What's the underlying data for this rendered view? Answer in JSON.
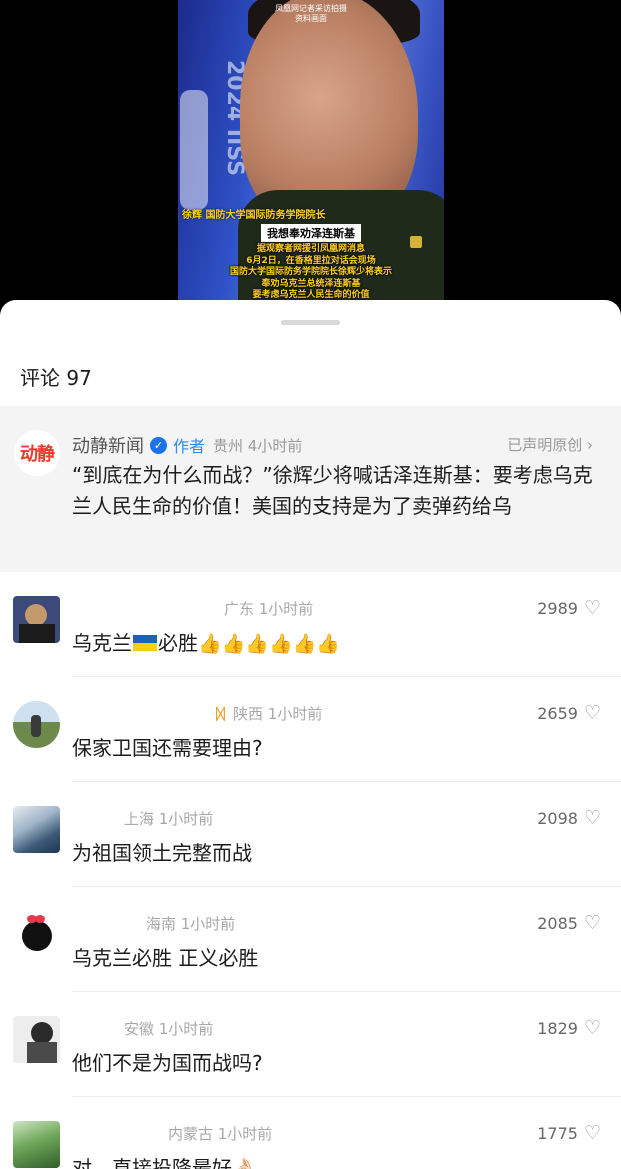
{
  "video": {
    "top_caption_lines": [
      "凤凰网记者采访拍摄",
      "资料画面"
    ],
    "side_text": "2024 IISS",
    "name_caption": "徐辉 国防大学国际防务学院院长",
    "quote": "我想奉劝泽连斯基",
    "news_lines": [
      "据观察者网援引凤凰网消息",
      "6月2日，在香格里拉对话会现场",
      "国防大学国际防务学院院长徐辉少将表示",
      "奉劝乌克兰总统泽连斯基",
      "要考虑乌克兰人民生命的价值"
    ]
  },
  "comments_header": {
    "count_label": "评论 97"
  },
  "pinned": {
    "logo_text": "动静",
    "name": "动静新闻",
    "verified_icon": "check",
    "author_tag": "作者",
    "meta": "贵州 4小时前",
    "original_label": "已声明原创 ›",
    "text": "“到底在为什么而战？”徐辉少将喊话泽连斯基：要考虑乌克兰人民生命的价值！美国的支持是为了卖弹药给乌"
  },
  "comments": [
    {
      "meta": "广东 1小时前",
      "likes": "2989",
      "text_pre": "乌克兰",
      "text_mid": "必胜",
      "thumbs": "👍👍👍👍👍👍",
      "avatar": "#3b4a7a"
    },
    {
      "badge": "ᛞ",
      "meta": "陕西 1小时前",
      "likes": "2659",
      "text": "保家卫国还需要理由?",
      "avatar": "#8aa070"
    },
    {
      "meta": "上海 1小时前",
      "likes": "2098",
      "text": "为祖国领土完整而战",
      "avatar": "#4f6e8a"
    },
    {
      "meta": "海南 1小时前",
      "likes": "2085",
      "text": "乌克兰必胜 正义必胜",
      "avatar": "#ffffff"
    },
    {
      "meta": "安徽 1小时前",
      "likes": "1829",
      "text": "他们不是为国而战吗?",
      "avatar": "#e8e8e8"
    },
    {
      "meta": "内蒙古 1小时前",
      "likes": "1775",
      "text": "对，直接投降最好👌🏻",
      "avatar": "#3e7a3a"
    }
  ],
  "colors": {
    "accent": "#2e8be6",
    "brand_red": "#e8392b"
  }
}
